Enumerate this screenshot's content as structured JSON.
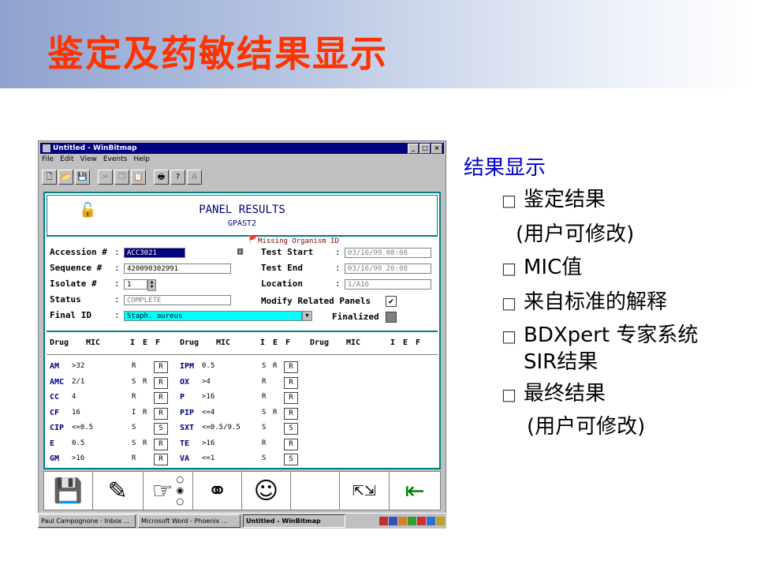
{
  "slide_title": "鉴定及药敏结果显示",
  "window": {
    "title": "Untitled - WinBitmap",
    "controls": [
      "_",
      "□",
      "×"
    ],
    "menu": [
      "File",
      "Edit",
      "View",
      "Events",
      "Help"
    ]
  },
  "panel": {
    "title": "PANEL RESULTS",
    "subtitle": "GPAST2",
    "missing_label": "Missing Organism ID",
    "fields": {
      "accession_label": "Accession #",
      "accession_value": "ACC3021",
      "sequence_label": "Sequence #",
      "sequence_value": "420090302991",
      "isolate_label": "Isolate #",
      "isolate_value": "1",
      "status_label": "Status",
      "status_value": "COMPLETE",
      "final_id_label": "Final ID",
      "final_id_value": "Staph. aureus",
      "test_start_label": "Test Start",
      "test_start_value": "03/16/99 08:08",
      "test_end_label": "Test End",
      "test_end_value": "03/16/99 20:08",
      "location_label": "Location",
      "location_value": "1/A16",
      "modify_label": "Modify Related Panels",
      "finalized_label": "Finalized"
    },
    "drug_headers": [
      "Drug",
      "MIC",
      "I",
      "E",
      "F"
    ],
    "drugs_col1": [
      {
        "drug": "AM",
        "mic": ">32",
        "i": "R",
        "e": "",
        "f": "R"
      },
      {
        "drug": "AMC",
        "mic": "2/1",
        "i": "S",
        "e": "R",
        "f": "R"
      },
      {
        "drug": "CC",
        "mic": "4",
        "i": "R",
        "e": "",
        "f": "R"
      },
      {
        "drug": "CF",
        "mic": "16",
        "i": "I",
        "e": "R",
        "f": "R"
      },
      {
        "drug": "CIP",
        "mic": "<=0.5",
        "i": "S",
        "e": "",
        "f": "S"
      },
      {
        "drug": "E",
        "mic": "0.5",
        "i": "S",
        "e": "R",
        "f": "R"
      },
      {
        "drug": "GM",
        "mic": ">16",
        "i": "R",
        "e": "",
        "f": "R"
      }
    ],
    "drugs_col2": [
      {
        "drug": "IPM",
        "mic": "0.5",
        "i": "S",
        "e": "R",
        "f": "R"
      },
      {
        "drug": "OX",
        "mic": ">4",
        "i": "R",
        "e": "",
        "f": "R"
      },
      {
        "drug": "P",
        "mic": ">16",
        "i": "R",
        "e": "",
        "f": "R"
      },
      {
        "drug": "PIP",
        "mic": "<=4",
        "i": "S",
        "e": "R",
        "f": "R"
      },
      {
        "drug": "SXT",
        "mic": "<=0.5/9.5",
        "i": "S",
        "e": "",
        "f": "S"
      },
      {
        "drug": "TE",
        "mic": ">16",
        "i": "R",
        "e": "",
        "f": "R"
      },
      {
        "drug": "VA",
        "mic": "<=1",
        "i": "S",
        "e": "",
        "f": "S"
      }
    ]
  },
  "taskbar": {
    "tasks": [
      "Paul Campognone - Inbox ...",
      "Microsoft Word - Phoenix ...",
      "Untitled - WinBitmap"
    ]
  },
  "side": {
    "heading": "结果显示",
    "items": [
      "鉴定结果",
      "(用户可修改)",
      "MIC值",
      "来自标准的解释",
      "BDXpert 专家系统",
      "SIR结果",
      "最终结果",
      "(用户可修改)"
    ]
  },
  "colors": {
    "title": "#ff3300",
    "heading": "#0000cc",
    "panel_border": "#008080",
    "drug_name": "#000080"
  }
}
